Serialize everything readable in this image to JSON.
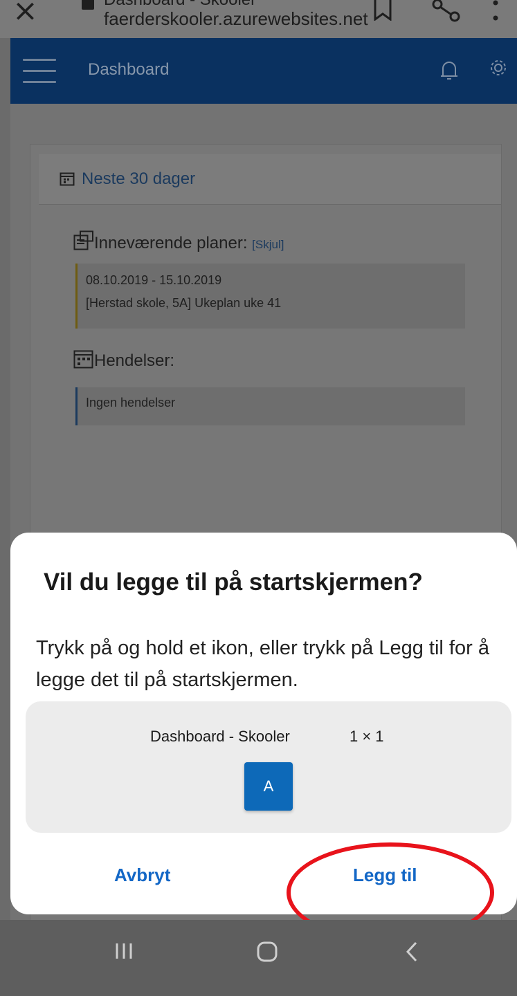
{
  "browser": {
    "tab_title": "Dashboard - Skooler",
    "url": "faerderskooler.azurewebsites.net"
  },
  "appbar": {
    "title": "Dashboard"
  },
  "card": {
    "header": "Neste 30 dager",
    "plans_label": "Inneværende planer:",
    "plans_hide_link": "[Skjul]",
    "plans": [
      {
        "dates": "08.10.2019 - 15.10.2019",
        "title": "[Herstad skole, 5A] Ukeplan uke 41"
      }
    ],
    "events_label": "Hendelser:",
    "events_empty": "Ingen hendelser"
  },
  "dialog": {
    "heading": "Vil du legge til på startskjermen?",
    "body": "Trykk på og hold et ikon, eller trykk på Legg til for å legge det til på startskjermen.",
    "preview_name": "Dashboard - Skooler",
    "preview_size": "1 × 1",
    "preview_icon_letter": "A",
    "cancel_label": "Avbryt",
    "add_label": "Legg til"
  },
  "colors": {
    "accent_blue": "#1367c6",
    "app_icon_blue": "#0d69b8",
    "highlight_ring": "#e8131b"
  }
}
